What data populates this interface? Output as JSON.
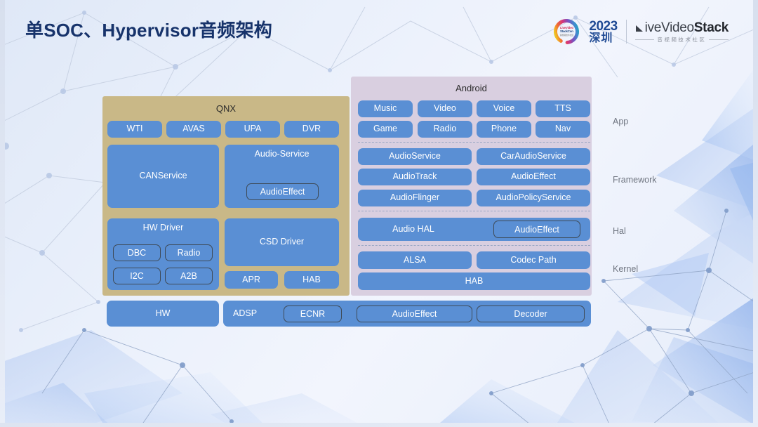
{
  "slide": {
    "title": "单SOC、Hypervisor音频架构",
    "title_color": "#17336b",
    "background_color": "#e8eef9"
  },
  "brand": {
    "ring_line1": "LiveVideo",
    "ring_line2": "StackCon",
    "ring_line3": "音视频技术社区",
    "year": "2023",
    "city": "深圳",
    "logo_text_light": "iveVideo",
    "logo_text_bold": "Stack",
    "logo_subtitle": "音视频技术社区",
    "play_icon": "play-triangle-icon"
  },
  "colors": {
    "qnx_panel": "#c9b887",
    "android_panel": "#d9cfe0",
    "box_blue": "#5a8fd4",
    "outline_stroke": "#3e4a57",
    "dashed_separator": "#9aa7c4",
    "layer_label": "#6f7580"
  },
  "qnx": {
    "title": "QNX",
    "services_row": [
      "WTI",
      "AVAS",
      "UPA",
      "DVR"
    ],
    "canservice": "CANService",
    "audio_service": "Audio-Service",
    "audio_service_child": "AudioEffect",
    "hw_driver": "HW Driver",
    "hw_driver_children": [
      "DBC",
      "Radio",
      "I2C",
      "A2B"
    ],
    "csd_driver": "CSD Driver",
    "csd_row": [
      "APR",
      "HAB"
    ]
  },
  "android": {
    "title": "Android",
    "apps_row1": [
      "Music",
      "Video",
      "Voice",
      "TTS"
    ],
    "apps_row2": [
      "Game",
      "Radio",
      "Phone",
      "Nav"
    ],
    "framework_rows": [
      [
        "AudioService",
        "CarAudioService"
      ],
      [
        "AudioTrack",
        "AudioEffect"
      ],
      [
        "AudioFlinger",
        "AudioPolicyService"
      ]
    ],
    "hal_label": "Audio HAL",
    "hal_child": "AudioEffect",
    "kernel_row": [
      "ALSA",
      "Codec Path"
    ],
    "kernel_hab": "HAB"
  },
  "layer_labels": [
    "App",
    "Framework",
    "Hal",
    "Kernel"
  ],
  "bottom": {
    "hw": "HW",
    "adsp": "ADSP",
    "adsp_children": [
      "ECNR",
      "AudioEffect",
      "Decoder"
    ]
  }
}
